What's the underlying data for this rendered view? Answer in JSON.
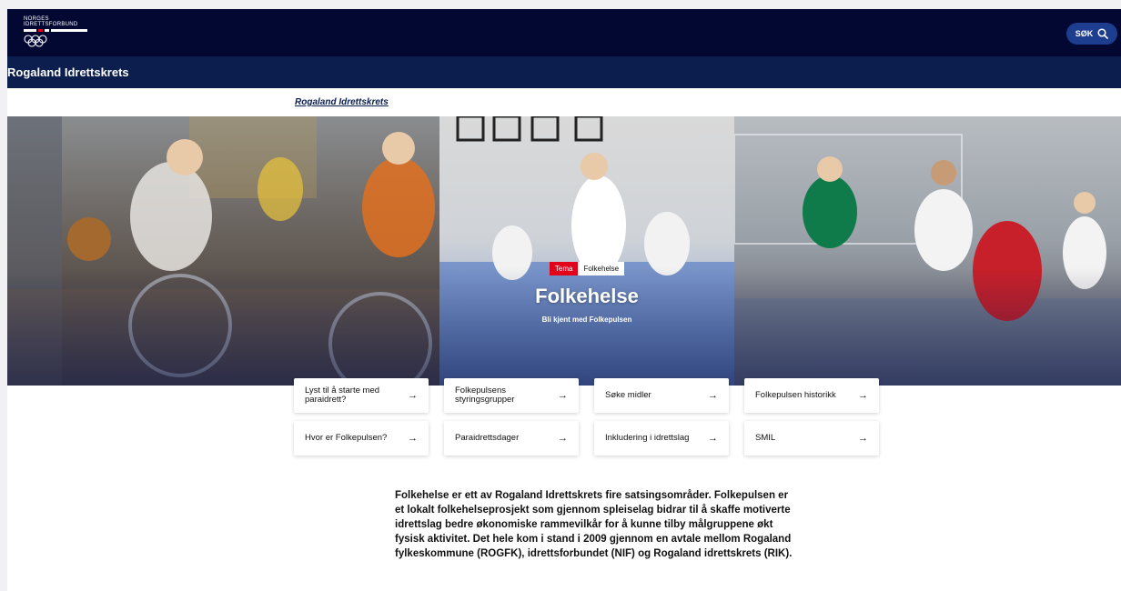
{
  "header": {
    "logo_line1": "NORGES",
    "logo_line2": "IDRETTSFORBUND",
    "search_label": "SØK"
  },
  "subheader": {
    "title": "Rogaland Idrettskrets"
  },
  "breadcrumb": {
    "label": "Rogaland Idrettskrets"
  },
  "hero": {
    "tag_type": "Tema",
    "tag_name": "Folkehelse",
    "title": "Folkehelse",
    "subtitle": "Bli kjent med Folkepulsen"
  },
  "cards": [
    {
      "label": "Lyst til å starte med paraidrett?"
    },
    {
      "label": "Folkepulsens styringsgrupper"
    },
    {
      "label": "Søke midler"
    },
    {
      "label": "Folkepulsen historikk"
    },
    {
      "label": "Hvor er Folkepulsen?"
    },
    {
      "label": "Paraidrettsdager"
    },
    {
      "label": "Inkludering i idrettslag"
    },
    {
      "label": "SMIL"
    }
  ],
  "body": {
    "text": "Folkehelse er ett av Rogaland Idrettskrets fire satsingsområder. Folkepulsen er et lokalt folkehelseprosjekt som gjennom spleiselag bidrar til å skaffe motiverte idrettslag bedre økonomiske rammevilkår for å kunne tilby målgruppene økt fysisk aktivitet. Det hele kom i stand i 2009 gjennom en avtale mellom Rogaland fylkeskommune (ROGFK), idrettsforbundet (NIF) og Rogaland idrettskrets (RIK)."
  },
  "colors": {
    "topbar": "#030833",
    "subbar": "#0c1e4e",
    "search_button": "#1d3d8f",
    "tag_red": "#e2001a"
  },
  "icons": {
    "search": "search-icon",
    "arrow": "arrow-right-icon",
    "logo": "olympic-rings-icon"
  }
}
